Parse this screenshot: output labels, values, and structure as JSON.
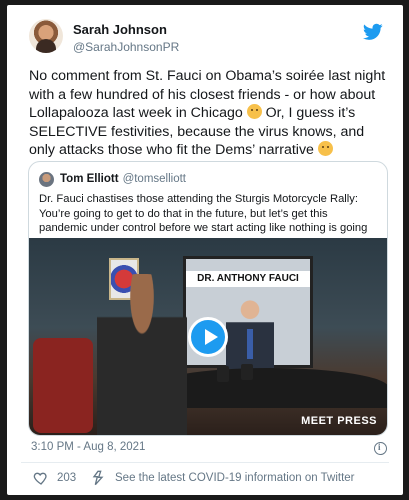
{
  "tweet": {
    "author_name": "Sarah Johnson",
    "author_handle": "@SarahJohnsonPR",
    "text_part1": "No comment from St. Fauci on Obama’s soirée last night with a few hundred of his closest friends - or how about Lollapalooza last week in Chicago",
    "text_part2": "Or, I guess it’s SELECTIVE festivities, because the virus knows, and only attacks those who fit the Dems’ narrative",
    "timestamp": "3:10 PM - Aug 8, 2021",
    "likes": "203",
    "covid_link": "See the latest COVID-19 information on Twitter"
  },
  "quote": {
    "author_name": "Tom Elliott",
    "author_handle": "@tomselliott",
    "text": "Dr. Fauci chastises those attending the Sturgis Motorcycle Rally: You’re going to get to do that in the future, but let’s get this pandemic under control before we start acting like nothing is going on.\"",
    "video_banner": "DR. ANTHONY FAUCI",
    "video_logo": "MEET PRESS"
  },
  "icons": {
    "twitter": "twitter-bird-icon",
    "play": "play-icon",
    "heart": "heart-icon",
    "share": "share-icon",
    "info": "info-icon",
    "emoji1": "thinking-face-emoji",
    "emoji2": "rolling-eyes-emoji"
  },
  "colors": {
    "accent": "#1d9bf0",
    "text": "#14171a",
    "secondary": "#657786"
  }
}
